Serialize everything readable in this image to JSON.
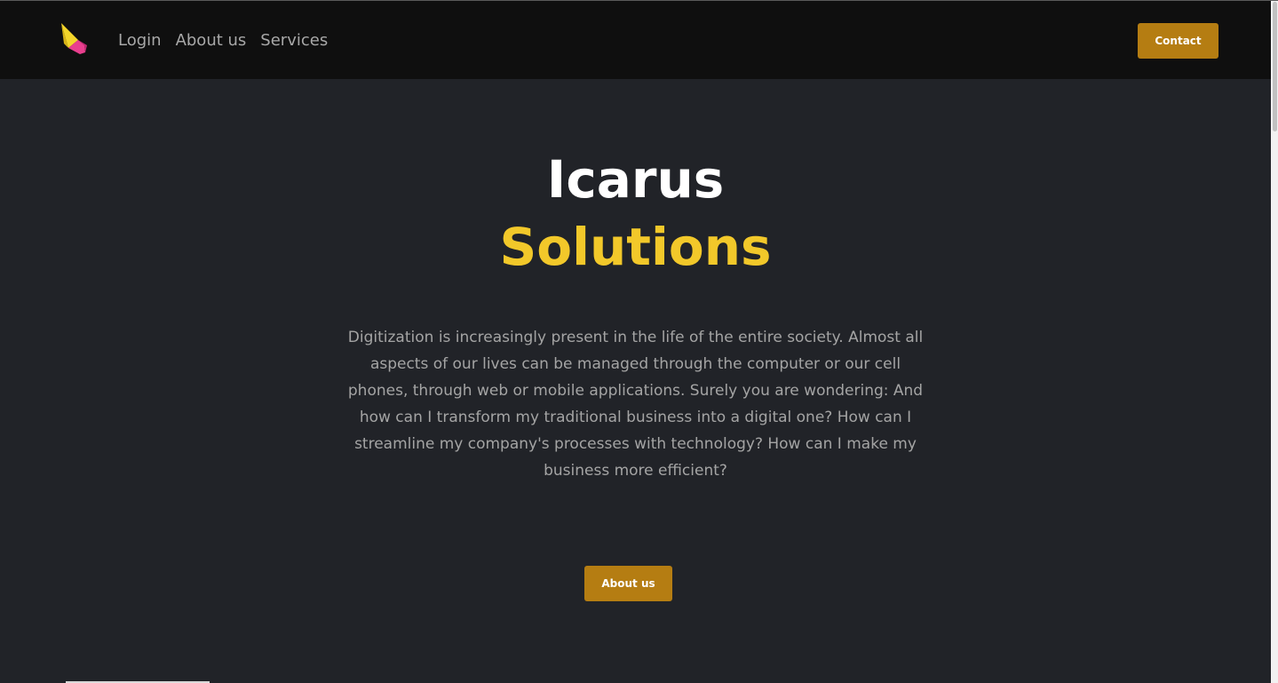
{
  "nav": {
    "logo_icon": "paper-plane-logo-icon",
    "links": [
      "Login",
      "About us",
      "Services"
    ],
    "contact_label": "Contact"
  },
  "hero": {
    "title_line1": "Icarus",
    "title_line2": "Solutions",
    "description": "Digitization is increasingly present in the life of the entire society. Almost all aspects of our lives can be managed through the computer or our cell phones, through web or mobile applications. Surely you are wondering: And how can I transform my traditional business into a digital one? How can I streamline my company's processes with technology? How can I make my business more efficient?",
    "button_label": "About us"
  },
  "colors": {
    "page_bg": "#212328",
    "nav_bg": "#0f0f0f",
    "accent": "#b57d12",
    "title_highlight": "#f2c82a"
  }
}
